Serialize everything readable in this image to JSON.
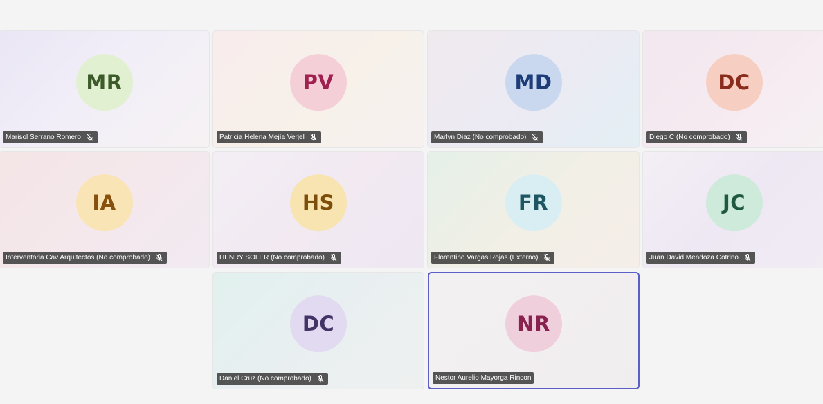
{
  "participants": [
    {
      "initials": "MR",
      "name": "Marisol Serrano Romero",
      "muted": true,
      "avatar_bg": "#e2f0d2",
      "avatar_fg": "#3d5a2a",
      "tile_bg": "linear-gradient(135deg, #eae6f5 0%, #f1eef8 45%, #f6f2f3 100%)"
    },
    {
      "initials": "PV",
      "name": "Patricia Helena Mejía Verjel",
      "muted": true,
      "avatar_bg": "#f5cfd8",
      "avatar_fg": "#a02150",
      "tile_bg": "linear-gradient(135deg, #f8ecec 0%, #f7f1ea 55%, #f6f1ef 100%)"
    },
    {
      "initials": "MD",
      "name": "Marlyn Diaz (No comprobado)",
      "muted": true,
      "avatar_bg": "#c9d8ef",
      "avatar_fg": "#1d3d78",
      "tile_bg": "linear-gradient(135deg, #efeaee 0%, #eceaf3 50%, #e3eff4 100%)"
    },
    {
      "initials": "DC",
      "name": "Diego C (No comprobado)",
      "muted": true,
      "avatar_bg": "#f6cfc2",
      "avatar_fg": "#8a2c1c",
      "tile_bg": "linear-gradient(135deg, #f3e7f0 0%, #f6eaf1 50%, #f5f0f2 100%)"
    },
    {
      "initials": "IA",
      "name": "Interventoria Cav Arquitectos (No comprobado)",
      "muted": true,
      "avatar_bg": "#f8e4b4",
      "avatar_fg": "#87500d",
      "tile_bg": "linear-gradient(135deg, #f4e5e6 0%, #f4e8ec 50%, #f1eaf1 100%)"
    },
    {
      "initials": "HS",
      "name": "HENRY SOLER (No comprobado)",
      "muted": true,
      "avatar_bg": "#f7e4b1",
      "avatar_fg": "#7c4e0a",
      "tile_bg": "linear-gradient(135deg, #f3eef5 0%, #f2e9f1 50%, #eee8f3 100%)"
    },
    {
      "initials": "FR",
      "name": "Florentino Vargas Rojas (Externo)",
      "muted": true,
      "avatar_bg": "#d9eef2",
      "avatar_fg": "#1e5664",
      "tile_bg": "linear-gradient(135deg, #e5f0e8 0%, #f1efe6 50%, #f5eee8 100%)"
    },
    {
      "initials": "JC",
      "name": "Juan David Mendoza Cotrino",
      "muted": true,
      "avatar_bg": "#cdeadb",
      "avatar_fg": "#1f5a3e",
      "tile_bg": "linear-gradient(135deg, #f4eef5 0%, #ede8f3 50%, #f1ebf4 100%)"
    },
    {
      "initials": "DC",
      "name": "Daniel Cruz (No comprobado)",
      "muted": true,
      "avatar_bg": "#e2daf0",
      "avatar_fg": "#433367",
      "tile_bg": "linear-gradient(135deg, #e1f0ee 0%, #e9eff1 50%, #eef0ef 100%)"
    },
    {
      "initials": "NR",
      "name": "Nestor Aurelio Mayorga Rincon",
      "muted": false,
      "active": true,
      "avatar_bg": "#f0cfdc",
      "avatar_fg": "#8a2250",
      "tile_bg": "linear-gradient(135deg, #f3f0f2 0%, #f2eff0 50%, #f0edee 100%)"
    }
  ]
}
